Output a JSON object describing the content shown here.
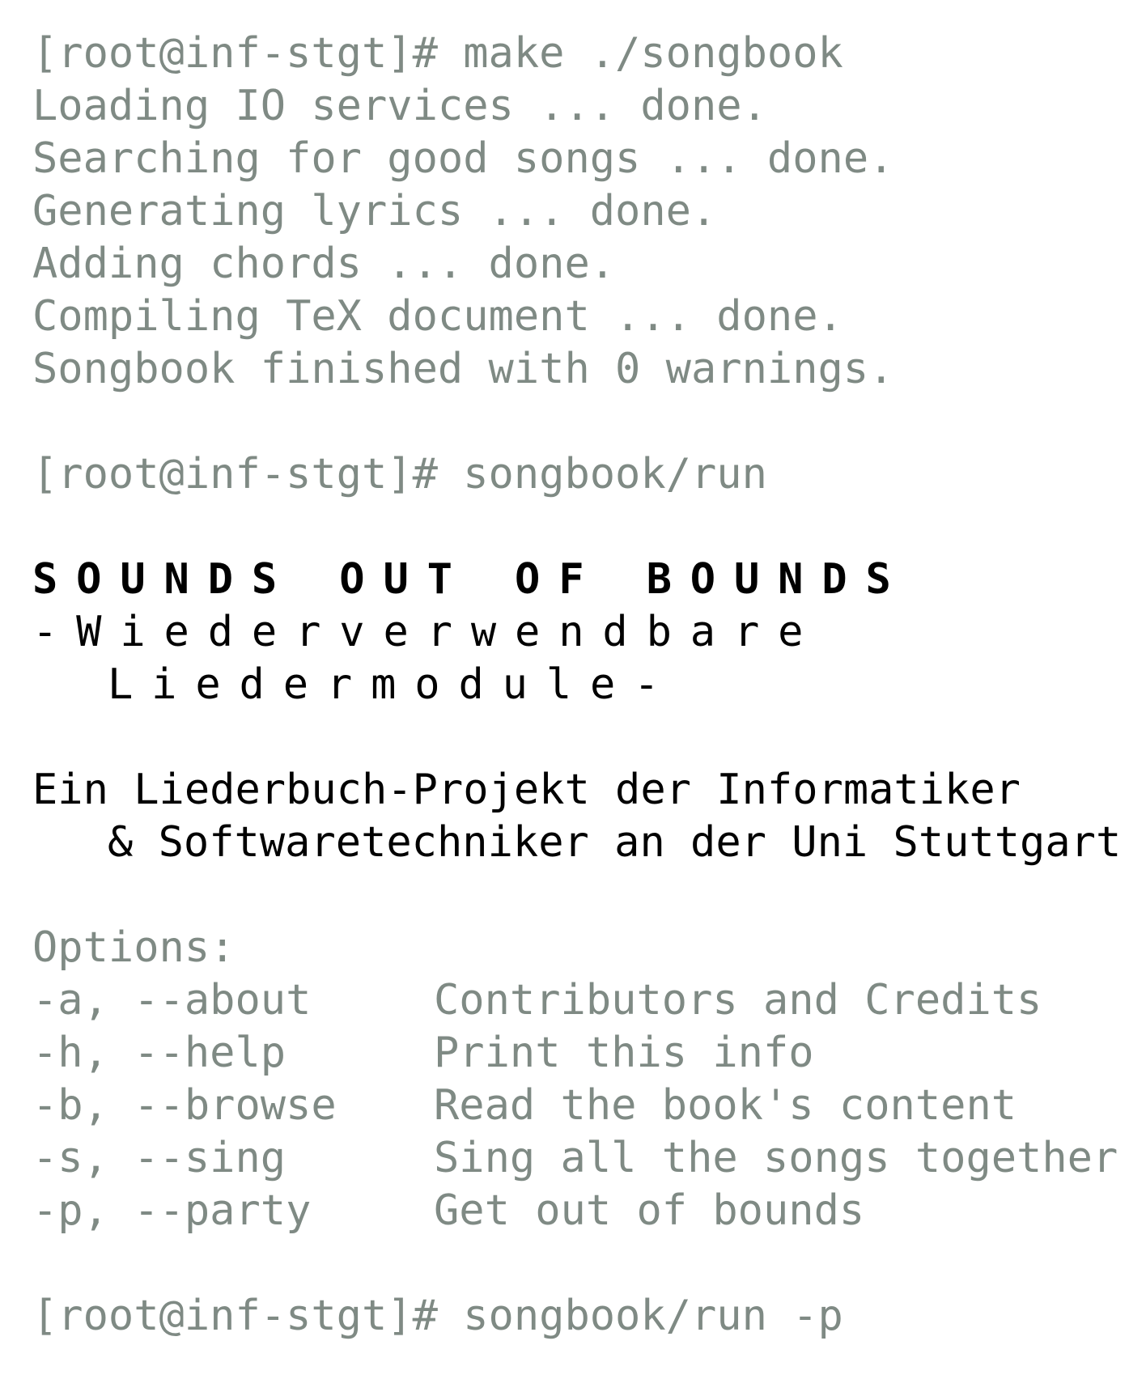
{
  "prompt": "[root@inf-stgt]# ",
  "commands": {
    "make": "make ./songbook",
    "run": "songbook/run",
    "run_party": "songbook/run -p"
  },
  "build_output": [
    "Loading IO services ... done.",
    "Searching for good songs ... done.",
    "Generating lyrics ... done.",
    "Adding chords ... done.",
    "Compiling TeX document ... done.",
    "Songbook finished with 0 warnings."
  ],
  "banner": {
    "title": "SOUNDS OUT OF BOUNDS",
    "subtitle_line1": "-Wiederverwendbare",
    "subtitle_line2": "Liedermodule-",
    "description_line1": "Ein Liederbuch-Projekt der Informatiker",
    "description_line2": "& Softwaretechniker an der Uni Stuttgart"
  },
  "options": {
    "header": "Options:",
    "items": [
      {
        "flag": "-a, --about",
        "description": "Contributors and Credits"
      },
      {
        "flag": "-h, --help",
        "description": "Print this info"
      },
      {
        "flag": "-b, --browse",
        "description": "Read the book's content"
      },
      {
        "flag": "-s, --sing",
        "description": "Sing all the songs together"
      },
      {
        "flag": "-p, --party",
        "description": "Get out of bounds"
      }
    ]
  },
  "colors": {
    "muted_text": "#7f8a84",
    "emphasis_text": "#000000",
    "background": "#ffffff"
  }
}
